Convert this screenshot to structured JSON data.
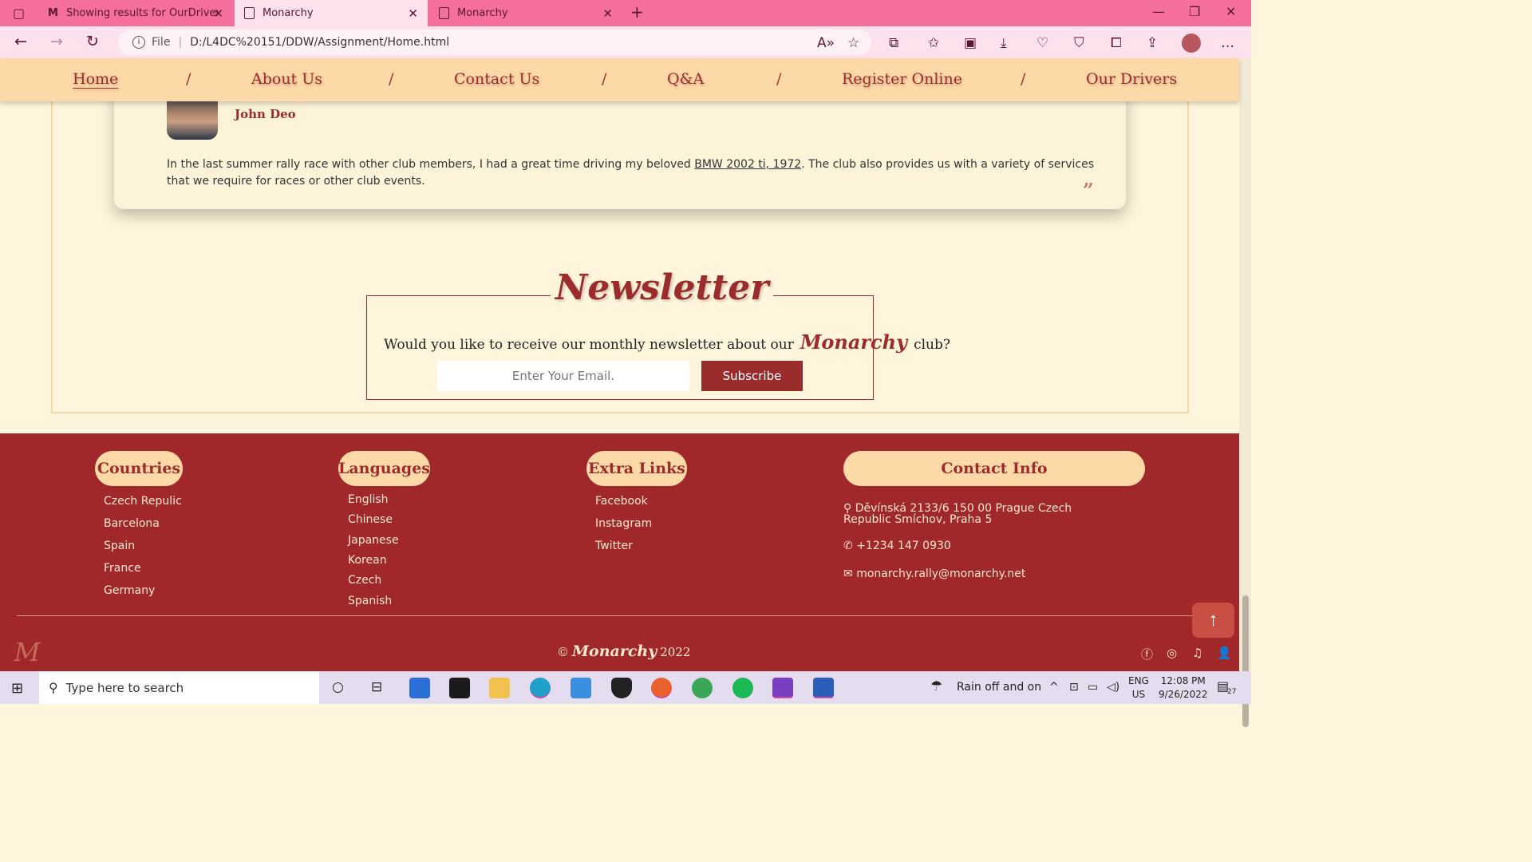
{
  "browser": {
    "tabs": [
      {
        "title": "Showing results for OurDrivers.h",
        "active": false
      },
      {
        "title": "Monarchy",
        "active": true
      },
      {
        "title": "Monarchy",
        "active": false
      }
    ],
    "url_label": "File",
    "url": "D:/L4DC%20151/DDW/Assignment/Home.html"
  },
  "nav": {
    "items": [
      "Home",
      "About Us",
      "Contact Us",
      "Q&A",
      "Register Online",
      "Our Drivers"
    ],
    "separator": "/"
  },
  "testimonial": {
    "name": "John Deo",
    "text_before": "In the last summer rally race with other club members, I had a great time driving my beloved ",
    "car_link": "BMW 2002 ti, 1972",
    "text_after": ". The club also provides us with a variety of services that we require for races or other club events.",
    "quote_mark": "”"
  },
  "newsletter": {
    "title": "Newsletter",
    "question_before": "Would you like to receive our monthly newsletter about our",
    "brand": "Monarchy",
    "question_after": "club?",
    "email_placeholder": "Enter Your Email.",
    "subscribe_label": "Subscribe"
  },
  "footer": {
    "countries": {
      "heading": "Countries",
      "items": [
        "Czech Repulic",
        "Barcelona",
        "Spain",
        "France",
        "Germany"
      ]
    },
    "languages": {
      "heading": "Languages",
      "items": [
        "English",
        "Chinese",
        "Japanese",
        "Korean",
        "Czech",
        "Spanish"
      ]
    },
    "links": {
      "heading": "Extra Links",
      "items": [
        "Facebook",
        "Instagram",
        "Twitter"
      ]
    },
    "contact": {
      "heading": "Contact Info",
      "address": "Děvínská 2133/6 150 00 Prague Czech Republic Smíchov, Praha 5",
      "phone": "+1234 147 0930",
      "email": "monarchy.rally@monarchy.net"
    },
    "copyright_symbol": "©",
    "brand": "Monarchy",
    "year": "2022",
    "colors": {
      "footer_bg": "#a0282a",
      "accent": "#9a2c2c",
      "pill": "#fed9a8"
    }
  },
  "taskbar": {
    "search_placeholder": "Type here to search",
    "weather": "Rain off and on",
    "lang_top": "ENG",
    "lang_bottom": "US",
    "time": "12:08 PM",
    "date": "9/26/2022",
    "notifications": "27"
  }
}
